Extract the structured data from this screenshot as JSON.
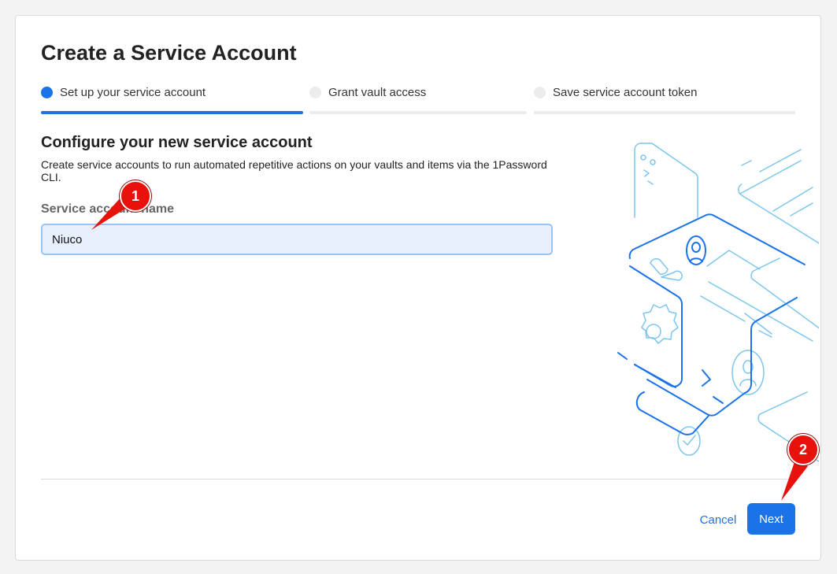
{
  "dialog": {
    "title": "Create a Service Account"
  },
  "steps": [
    {
      "label": "Set up your service account",
      "active": true
    },
    {
      "label": "Grant vault access",
      "active": false
    },
    {
      "label": "Save service account token",
      "active": false
    }
  ],
  "form": {
    "section_title": "Configure your new service account",
    "description": "Create service accounts to run automated repetitive actions on your vaults and items via the 1Password CLI.",
    "name_label": "Service account name",
    "name_value": "Niuco"
  },
  "footer": {
    "cancel_label": "Cancel",
    "next_label": "Next"
  },
  "annotations": [
    {
      "number": "1"
    },
    {
      "number": "2"
    }
  ],
  "colors": {
    "accent": "#1a73e8",
    "annotation": "#e8120c",
    "illustration_stroke_primary": "#1a73e8",
    "illustration_stroke_secondary": "#7dc6ee"
  }
}
